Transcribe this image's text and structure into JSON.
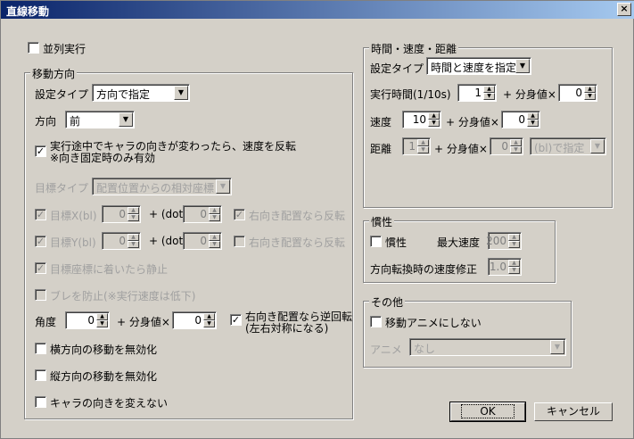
{
  "window": {
    "title": "直線移動",
    "close": "×"
  },
  "parallel": {
    "label": "並列実行",
    "checked": ""
  },
  "move_dir": {
    "legend": "移動方向",
    "setting_type_label": "設定タイプ",
    "setting_type_value": "方向で指定",
    "direction_label": "方向",
    "direction_value": "前",
    "reverse_label_1": "実行途中でキャラの向きが変わったら、速度を反転",
    "reverse_label_2": "※向き固定時のみ有効",
    "reverse_checked": "✓",
    "target_type_label": "目標タイプ",
    "target_type_value": "配置位置からの相対座標",
    "target_x_label": "目標X(bl)",
    "target_x_value": "0",
    "dot_label": "+ (dot)",
    "dot_x_value": "0",
    "right_flip_label": "右向き配置なら反転",
    "target_y_label": "目標Y(bl)",
    "target_y_value": "0",
    "dot_y_value": "0",
    "right_flip_y_label": "右向き配置なら反転",
    "stop_label": "目標座標に着いたら静止",
    "shake_label": "ブレを防止(※実行速度は低下)",
    "angle_label": "角度",
    "angle_value": "0",
    "plus_body": "+ 分身値×",
    "angle_body_value": "0",
    "reverse_rot_1": "右向き配置なら逆回転",
    "reverse_rot_2": "(左右対称になる)",
    "reverse_rot_checked": "✓",
    "no_h_label": "横方向の移動を無効化",
    "no_v_label": "縦方向の移動を無効化",
    "no_turn_label": "キャラの向きを変えない"
  },
  "time_speed": {
    "legend": "時間・速度・距離",
    "setting_type_label": "設定タイプ",
    "setting_type_value": "時間と速度を指定",
    "exec_time_label": "実行時間(1/10s)",
    "exec_time_value": "1",
    "plus_body": "+ 分身値×",
    "exec_time_body": "0",
    "speed_label": "速度",
    "speed_value": "10",
    "speed_body": "0",
    "distance_label": "距離",
    "distance_value": "1",
    "distance_body": "0",
    "distance_type": "(bl)で指定"
  },
  "inertia": {
    "legend": "慣性",
    "label": "慣性",
    "max_speed_label": "最大速度",
    "max_speed_value": "200",
    "turn_label": "方向転換時の速度修正",
    "turn_value": "1.0"
  },
  "other": {
    "legend": "その他",
    "no_anim_label": "移動アニメにしない",
    "anim_label": "アニメ",
    "anim_value": "なし"
  },
  "buttons": {
    "ok": "OK",
    "cancel": "キャンセル"
  }
}
